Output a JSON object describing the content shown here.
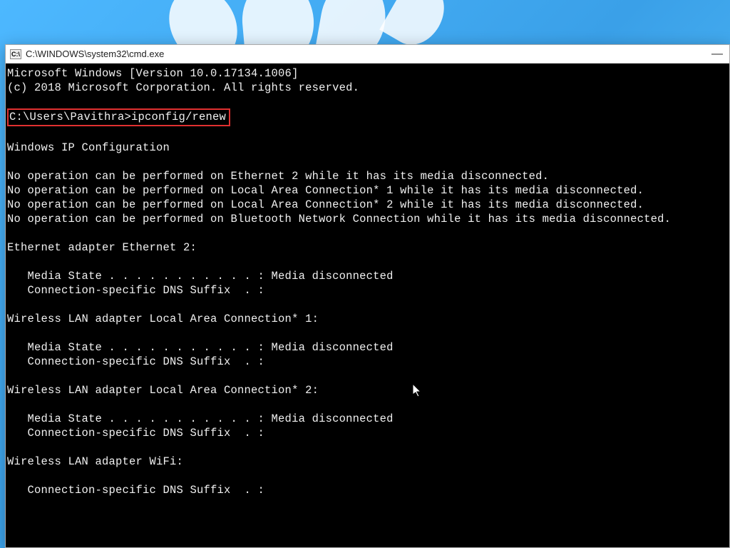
{
  "titlebar": {
    "icon_label": "C:\\",
    "title": "C:\\WINDOWS\\system32\\cmd.exe",
    "minimize": "—"
  },
  "terminal": {
    "line_version": "Microsoft Windows [Version 10.0.17134.1006]",
    "line_copyright": "(c) 2018 Microsoft Corporation. All rights reserved.",
    "prompt_command": "C:\\Users\\Pavithra>ipconfig/renew",
    "line_header": "Windows IP Configuration",
    "line_noop1": "No operation can be performed on Ethernet 2 while it has its media disconnected.",
    "line_noop2": "No operation can be performed on Local Area Connection* 1 while it has its media disconnected.",
    "line_noop3": "No operation can be performed on Local Area Connection* 2 while it has its media disconnected.",
    "line_noop4": "No operation can be performed on Bluetooth Network Connection while it has its media disconnected.",
    "adapter1_title": "Ethernet adapter Ethernet 2:",
    "adapter1_media": "   Media State . . . . . . . . . . . : Media disconnected",
    "adapter1_dns": "   Connection-specific DNS Suffix  . :",
    "adapter2_title": "Wireless LAN adapter Local Area Connection* 1:",
    "adapter2_media": "   Media State . . . . . . . . . . . : Media disconnected",
    "adapter2_dns": "   Connection-specific DNS Suffix  . :",
    "adapter3_title": "Wireless LAN adapter Local Area Connection* 2:",
    "adapter3_media": "   Media State . . . . . . . . . . . : Media disconnected",
    "adapter3_dns": "   Connection-specific DNS Suffix  . :",
    "adapter4_title": "Wireless LAN adapter WiFi:",
    "adapter4_dns": "   Connection-specific DNS Suffix  . :"
  },
  "annotation": {
    "highlight_color": "#e03030"
  }
}
